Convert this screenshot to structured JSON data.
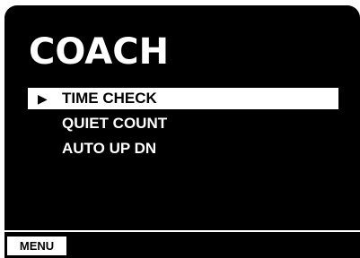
{
  "screen": {
    "title": "COACH"
  },
  "menu": {
    "items": [
      {
        "label": "TIME CHECK",
        "selected": true
      },
      {
        "label": "QUIET COUNT",
        "selected": false
      },
      {
        "label": "AUTO UP DN",
        "selected": false
      }
    ],
    "cursor_glyph": "▶"
  },
  "softkeys": {
    "left_label": "MENU"
  },
  "colors": {
    "background": "#000000",
    "foreground": "#ffffff"
  }
}
